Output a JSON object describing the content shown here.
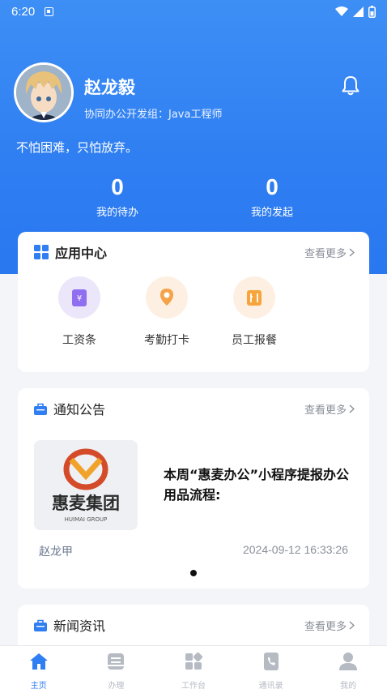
{
  "status_bar": {
    "time": "6:20"
  },
  "profile": {
    "name": "赵龙毅",
    "department": "协同办公开发组：Java工程师",
    "motto": "不怕困难，只怕放弃。"
  },
  "stats": [
    {
      "value": "0",
      "label": "我的待办"
    },
    {
      "value": "0",
      "label": "我的发起"
    }
  ],
  "app_center": {
    "title": "应用中心",
    "more_label": "查看更多",
    "apps": [
      {
        "label": "工资条",
        "icon": "payslip-icon"
      },
      {
        "label": "考勤打卡",
        "icon": "location-checkin-icon"
      },
      {
        "label": "员工报餐",
        "icon": "meal-order-icon"
      }
    ]
  },
  "notices": {
    "title": "通知公告",
    "more_label": "查看更多",
    "item": {
      "title": "本周“惠麦办公”小程序提报办公用品流程:",
      "author": "赵龙甲",
      "time": "2024-09-12 16:33:26",
      "logo_text": "惠麦集团",
      "logo_subtext": "HUIMAI GROUP"
    }
  },
  "news": {
    "title": "新闻资讯",
    "more_label": "查看更多"
  },
  "tabbar": {
    "items": [
      {
        "label": "主页",
        "active": true
      },
      {
        "label": "办理",
        "active": false
      },
      {
        "label": "工作台",
        "active": false
      },
      {
        "label": "通讯录",
        "active": false
      },
      {
        "label": "我的",
        "active": false
      }
    ]
  },
  "colors": {
    "primary": "#2f7ef2",
    "inactive": "#b5bac3"
  }
}
